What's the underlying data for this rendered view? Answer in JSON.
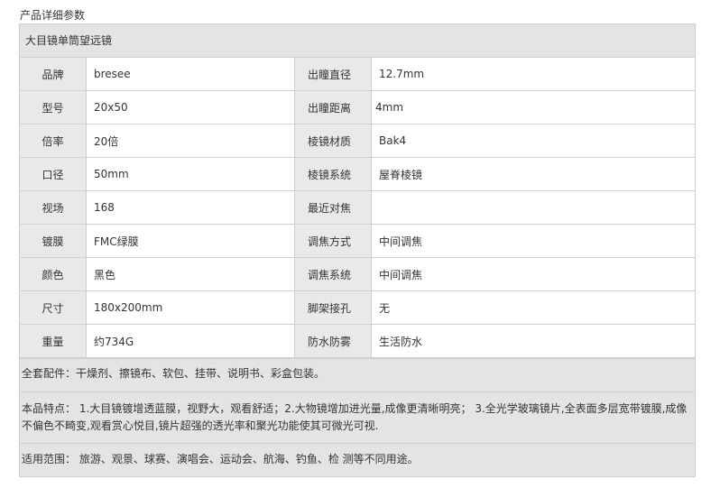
{
  "page_title": "产品详细参数",
  "table_caption": "大目镜单筒望远镜",
  "rows": [
    {
      "label1": "品牌",
      "value1": "bresee",
      "label2": "出瞳直径",
      "value2": "12.7mm"
    },
    {
      "label1": "型号",
      "value1": "20x50",
      "label2": "出瞳距离",
      "value2": "4mm"
    },
    {
      "label1": "倍率",
      "value1": "20倍",
      "label2": "棱镜材质",
      "value2": "Bak4"
    },
    {
      "label1": "口径",
      "value1": "50mm",
      "label2": "棱镜系统",
      "value2": "屋脊棱镜"
    },
    {
      "label1": "视场",
      "value1": "168",
      "label2": "最近对焦",
      "value2": ""
    },
    {
      "label1": "镀膜",
      "value1": "FMC绿膜",
      "label2": "调焦方式",
      "value2": "中间调焦"
    },
    {
      "label1": "颜色",
      "value1": "黑色",
      "label2": "调焦系统",
      "value2": "中间调焦"
    },
    {
      "label1": "尺寸",
      "value1": "180x200mm",
      "label2": "脚架接孔",
      "value2": "无"
    },
    {
      "label1": "重量",
      "value1": "约734G",
      "label2": "防水防雾",
      "value2": "生活防水"
    }
  ],
  "notes": {
    "accessories": "全套配件：干燥剂、擦镜布、软包、挂带、说明书、彩盒包装。",
    "features": "本品特点： 1.大目镜镀增透蓝膜，视野大，观看舒适；2.大物镜增加进光量,成像更清晰明亮；    3.全光学玻璃镜片,全表面多层宽带镀膜,成像不偏色不畸变,观看赏心悦目,镜片超强的透光率和聚光功能使其可微光可视.",
    "usage": "适用范围： 旅游、观景、球赛、演唱会、运动会、航海、钓鱼、检 测等不同用途。"
  }
}
